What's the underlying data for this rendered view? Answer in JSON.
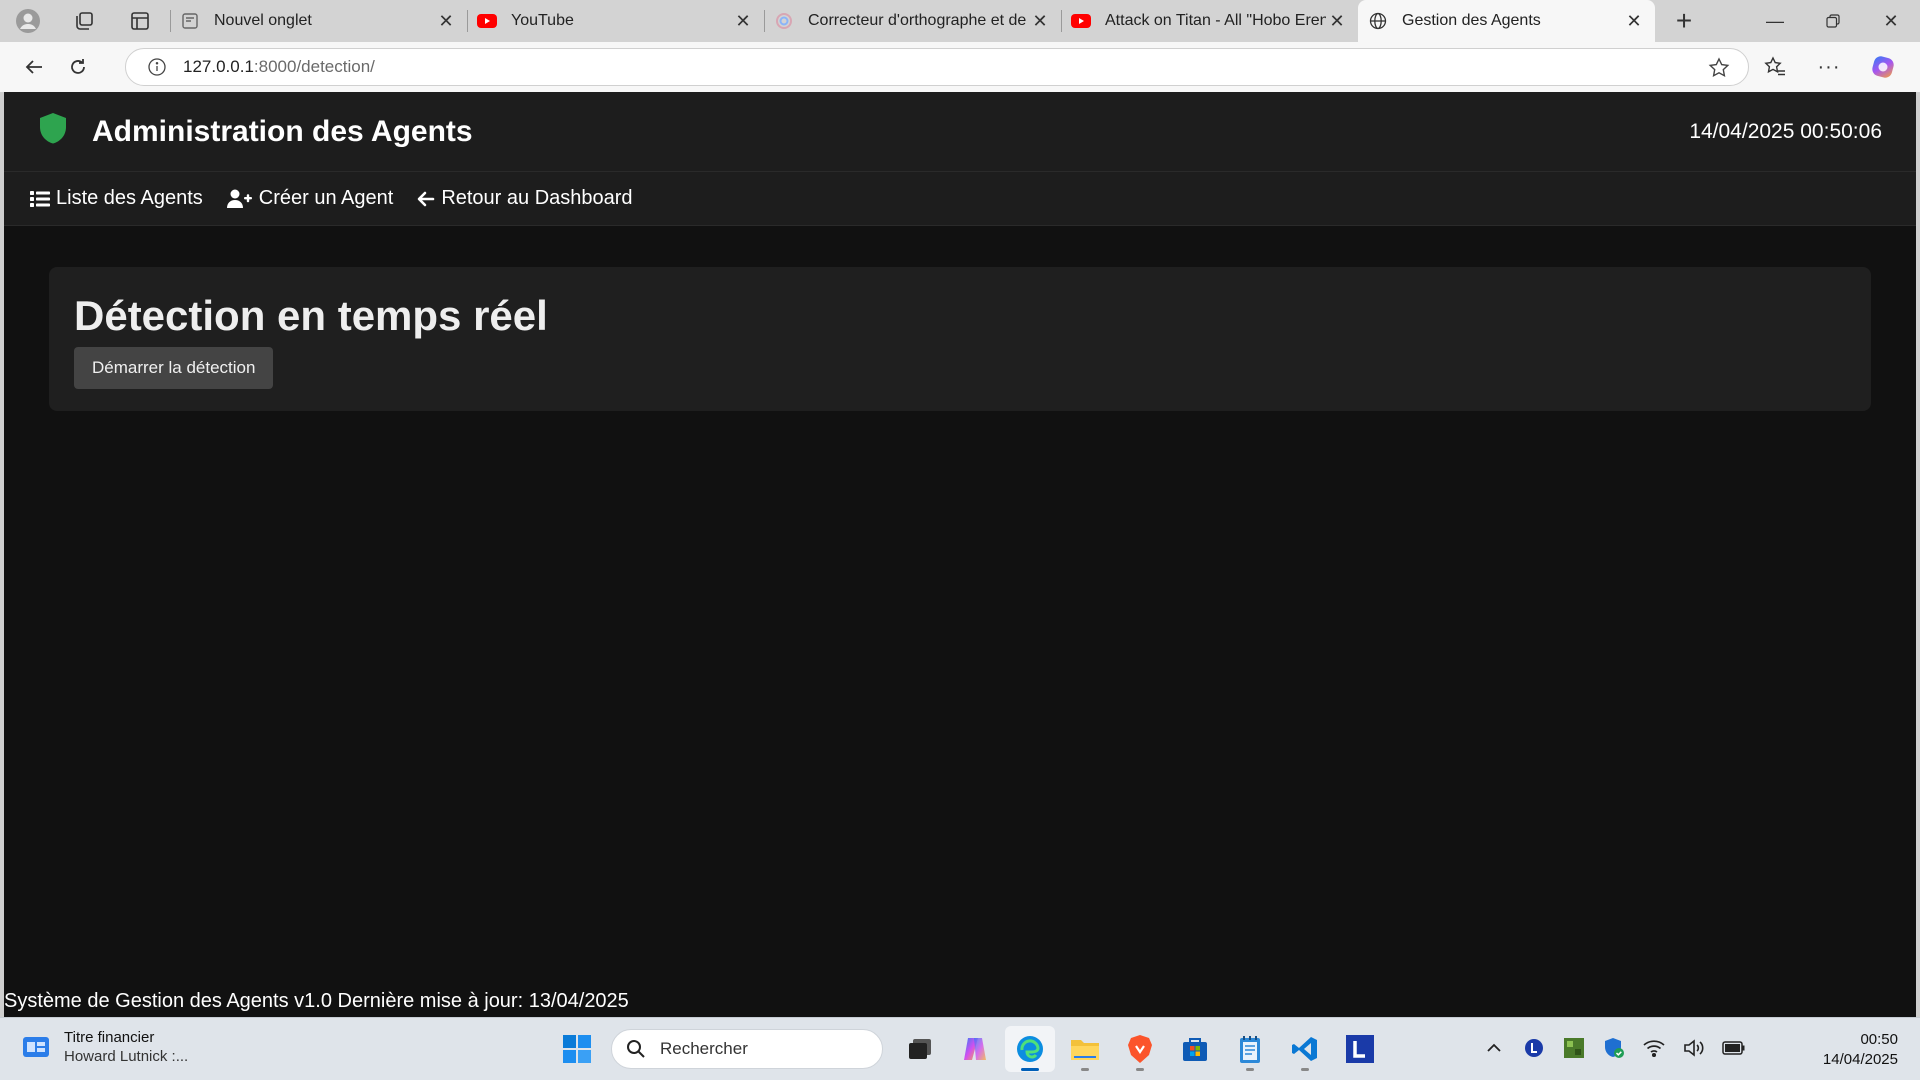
{
  "browser": {
    "tabs": [
      {
        "title": "Nouvel onglet",
        "icon": "new-tab-page-icon",
        "active": false
      },
      {
        "title": "YouTube",
        "icon": "youtube-icon",
        "active": false
      },
      {
        "title": "Correcteur d'orthographe et de g",
        "icon": "spellcheck-site-icon",
        "active": false
      },
      {
        "title": "Attack on Titan - All \"Hobo Eren\"",
        "icon": "youtube-icon",
        "active": false
      },
      {
        "title": "Gestion des Agents",
        "icon": "globe-icon",
        "active": true
      }
    ],
    "url_host": "127.0.0.1",
    "url_rest": ":8000/detection/"
  },
  "app": {
    "title": "Administration des Agents",
    "datetime": "14/04/2025 00:50:06",
    "nav": [
      {
        "label": "Liste des Agents",
        "icon": "list-icon"
      },
      {
        "label": "Créer un Agent",
        "icon": "user-plus-icon"
      },
      {
        "label": "Retour au Dashboard",
        "icon": "arrow-left-icon"
      }
    ],
    "heading": "Détection en temps réel",
    "start_button": "Démarrer la détection",
    "footer": "Système de Gestion des Agents v1.0 Dernière mise à jour: 13/04/2025",
    "colors": {
      "shield": "#2ea44f",
      "background": "#111111",
      "panel": "#1f1f1f"
    }
  },
  "taskbar": {
    "widget_title": "Titre financier",
    "widget_subtitle": "Howard Lutnick :...",
    "search_placeholder": "Rechercher",
    "time": "00:50",
    "date": "14/04/2025"
  }
}
